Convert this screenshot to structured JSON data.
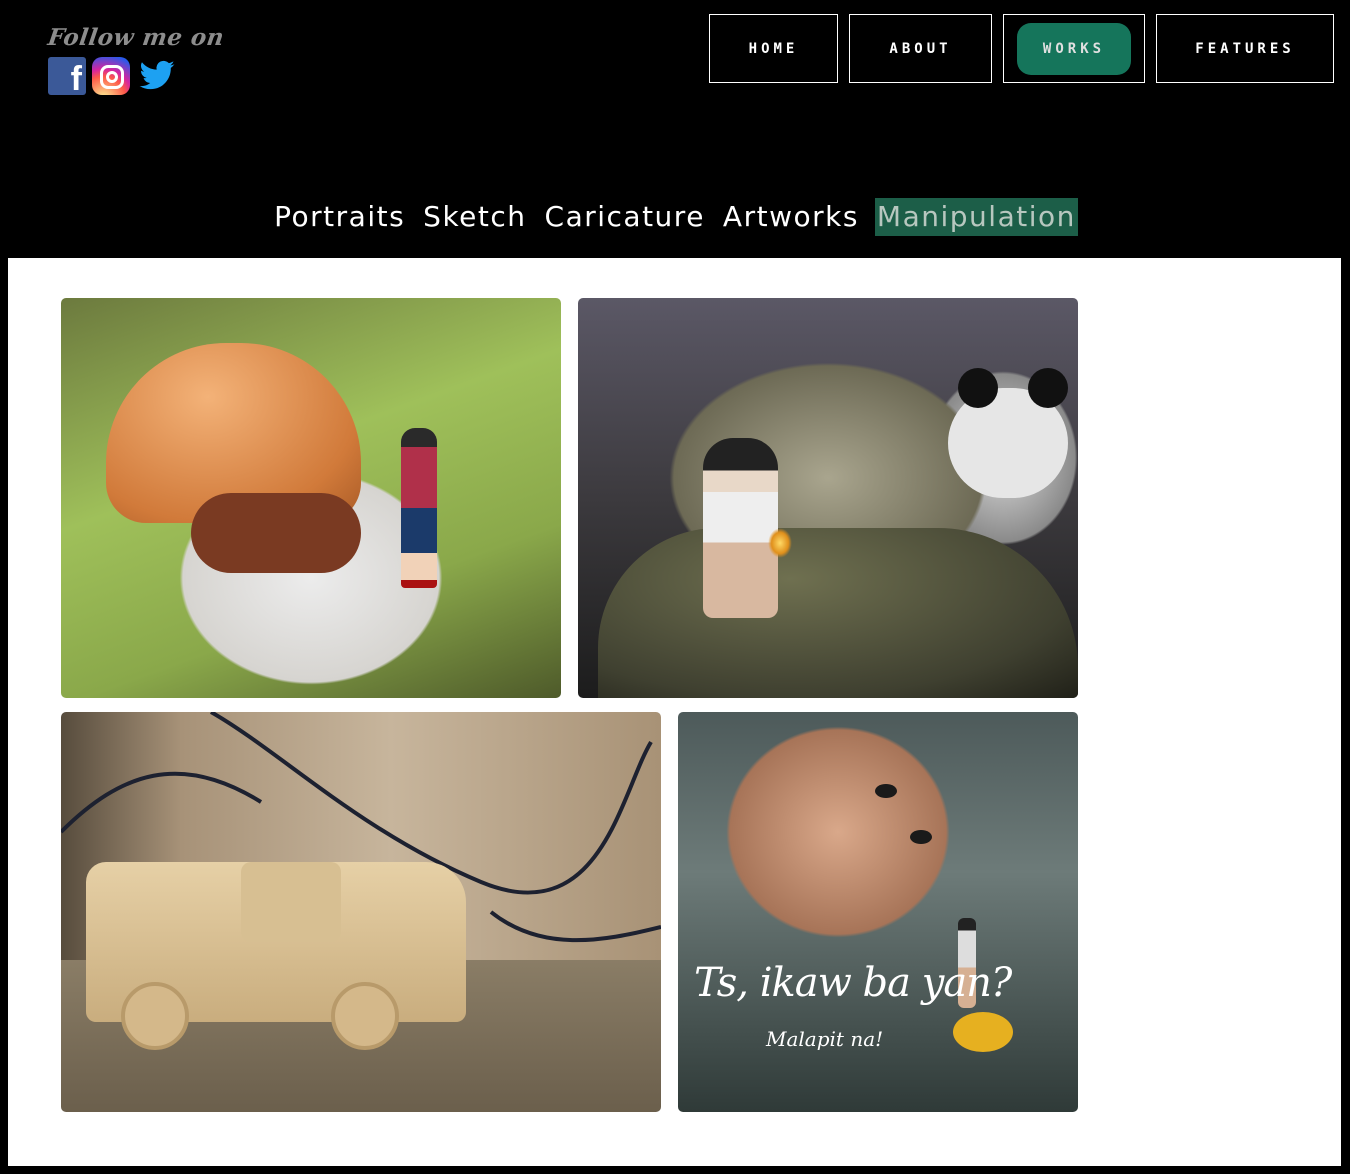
{
  "header": {
    "follow_text": "Follow me on",
    "social": [
      {
        "name": "facebook",
        "icon": "facebook-icon",
        "color": "#3b5998"
      },
      {
        "name": "instagram",
        "icon": "instagram-icon",
        "color": "#d6249f"
      },
      {
        "name": "twitter",
        "icon": "twitter-icon",
        "color": "#1da1f2"
      }
    ]
  },
  "nav": {
    "items": [
      {
        "label": "HOME"
      },
      {
        "label": "ABOUT"
      },
      {
        "label": "WORKS",
        "active": true
      },
      {
        "label": "FEATURES"
      }
    ],
    "active_color": "#15755b"
  },
  "categories": {
    "items": [
      {
        "label": "Portraits"
      },
      {
        "label": "Sketch"
      },
      {
        "label": "Caricature"
      },
      {
        "label": "Artworks"
      },
      {
        "label": "Manipulation",
        "active": true
      }
    ],
    "active_color": "#1c5e48"
  },
  "gallery": {
    "images": [
      {
        "subject": "burger-with-tiny-girl"
      },
      {
        "subject": "girl-on-rock-with-panda"
      },
      {
        "subject": "wooden-toy-truck"
      },
      {
        "subject": "giant-child-face",
        "caption": "Ts, ikaw ba yan?",
        "subcaption": "Malapit na!"
      }
    ]
  }
}
